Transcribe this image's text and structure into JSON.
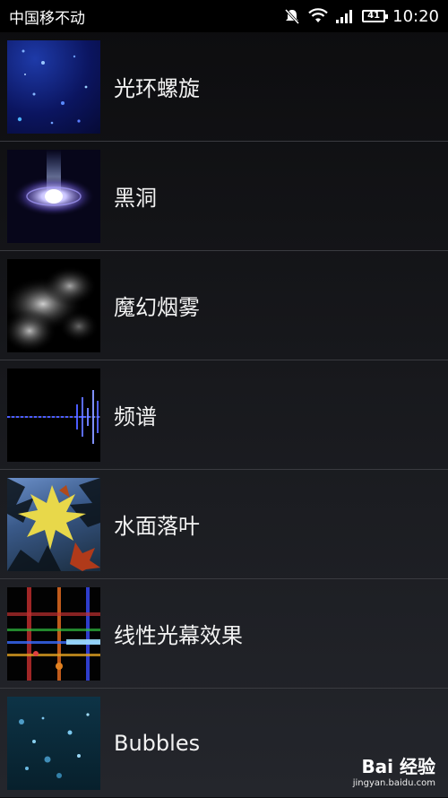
{
  "status_bar": {
    "carrier": "中国移不动",
    "battery": "41",
    "time": "10:20"
  },
  "items": [
    {
      "label": "光环螺旋",
      "thumb_icon": "galaxy-dots-thumbnail"
    },
    {
      "label": "黑洞",
      "thumb_icon": "black-hole-thumbnail"
    },
    {
      "label": "魔幻烟雾",
      "thumb_icon": "smoke-thumbnail"
    },
    {
      "label": "频谱",
      "thumb_icon": "spectrum-thumbnail"
    },
    {
      "label": "水面落叶",
      "thumb_icon": "maple-leaf-thumbnail"
    },
    {
      "label": "线性光幕效果",
      "thumb_icon": "light-lines-thumbnail"
    },
    {
      "label": "Bubbles",
      "thumb_icon": "bubbles-thumbnail"
    }
  ],
  "watermark": {
    "main": "Bai 经验",
    "sub": "jingyan.baidu.com"
  },
  "colors": {
    "background_top": "#0c0c0e",
    "background_bottom": "#24262c",
    "divider": "#3a3b40"
  }
}
